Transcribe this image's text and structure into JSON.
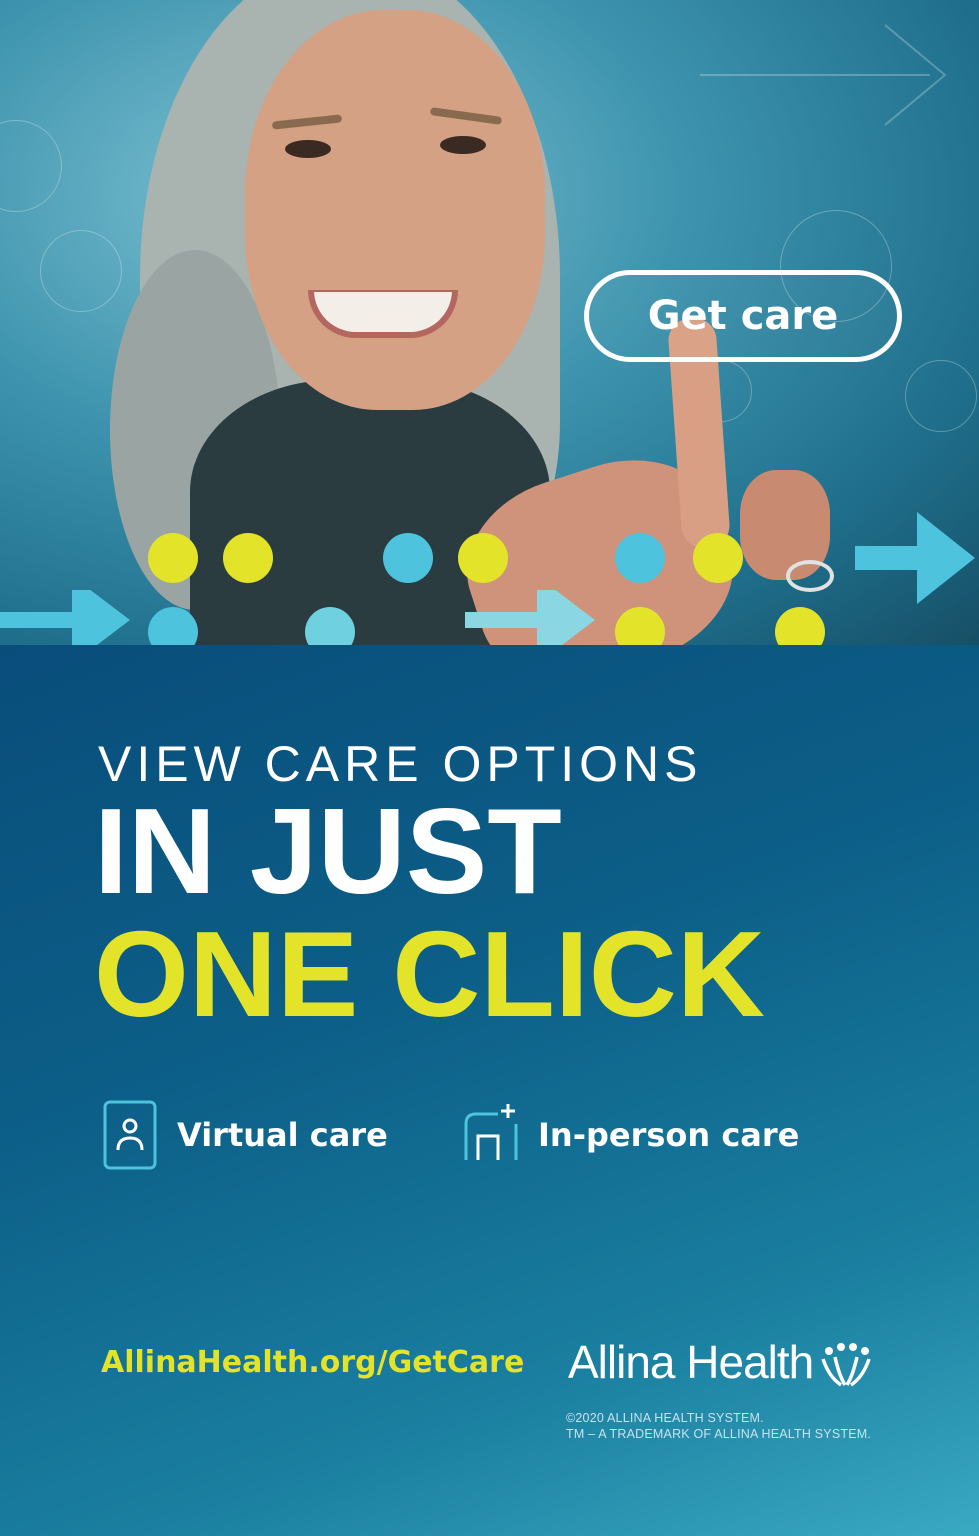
{
  "hero": {
    "button_label": "Get care"
  },
  "headline": {
    "line1": "VIEW CARE OPTIONS",
    "line2": "IN JUST",
    "line3": "ONE CLICK"
  },
  "options": [
    {
      "label": "Virtual care",
      "icon": "virtual-care-icon"
    },
    {
      "label": "In-person care",
      "icon": "in-person-care-icon"
    }
  ],
  "footer": {
    "url": "AllinaHealth.org/GetCare",
    "brand": "Allina Health",
    "legal_line1": "©2020 ALLINA HEALTH SYSTEM.",
    "legal_line2": "TM – A TRADEMARK OF ALLINA HEALTH SYSTEM."
  },
  "colors": {
    "accent_yellow": "#e3e32a",
    "accent_cyan": "#4dc3dd",
    "panel_blue": "#0c5f88",
    "white": "#ffffff"
  }
}
